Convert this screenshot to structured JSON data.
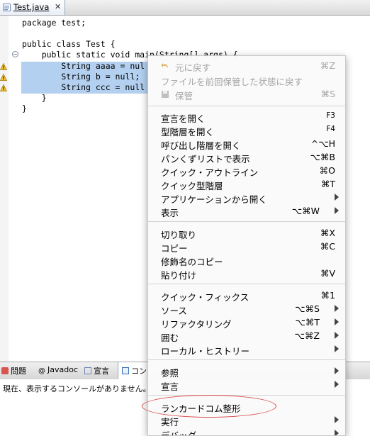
{
  "editor": {
    "tab_label": "Test.java",
    "close_symbol": "✕",
    "lines": [
      "package test;",
      "",
      "public class Test {",
      "    public static void main(String[] args) {",
      "        String aaaa = null;",
      "        String b = null;",
      "        String ccc = null;",
      "    }",
      "}"
    ],
    "line_fragments": {
      "l1": "package test;",
      "l3": "public class Test {",
      "l4": "    public static void main(String[] args) {",
      "l5": "        String aaaa = nul",
      "l6": "        String b = null;",
      "l7": "        String ccc = null",
      "l8": "    }",
      "l9": "}"
    },
    "fold_symbol": "−"
  },
  "bottom": {
    "tabs": [
      "問題",
      "Javadoc",
      "宣言",
      "コン"
    ],
    "console_message": "現在、表示するコンソールがありません。"
  },
  "menu": {
    "undo": {
      "label": "元に戻す",
      "shortcut": "⌘Z"
    },
    "revert": {
      "label": "ファイルを前回保管した状態に戻す"
    },
    "save": {
      "label": "保管",
      "shortcut": "⌘S"
    },
    "open_declaration": {
      "label": "宣言を開く",
      "shortcut": "F3"
    },
    "open_type_hierarchy": {
      "label": "型階層を開く",
      "shortcut": "F4"
    },
    "open_call_hierarchy": {
      "label": "呼び出し階層を開く",
      "shortcut": "^⌥H"
    },
    "show_in_breadcrumb": {
      "label": "パンくずリストで表示",
      "shortcut": "⌥⌘B"
    },
    "quick_outline": {
      "label": "クイック・アウトライン",
      "shortcut": "⌘O"
    },
    "quick_type_hierarchy": {
      "label": "クイック型階層",
      "shortcut": "⌘T"
    },
    "open_with": {
      "label": "アプリケーションから開く"
    },
    "show_in": {
      "label": "表示",
      "shortcut": "⌥⌘W"
    },
    "cut": {
      "label": "切り取り",
      "shortcut": "⌘X"
    },
    "copy": {
      "label": "コピー",
      "shortcut": "⌘C"
    },
    "copy_qualified": {
      "label": "修飾名のコピー"
    },
    "paste": {
      "label": "貼り付け",
      "shortcut": "⌘V"
    },
    "quick_fix": {
      "label": "クイック・フィックス",
      "shortcut": "⌘1"
    },
    "source": {
      "label": "ソース",
      "shortcut": "⌥⌘S"
    },
    "refactor": {
      "label": "リファクタリング",
      "shortcut": "⌥⌘T"
    },
    "surround": {
      "label": "囲む",
      "shortcut": "⌥⌘Z"
    },
    "local_history": {
      "label": "ローカル・ヒストリー"
    },
    "references": {
      "label": "参照"
    },
    "declarations": {
      "label": "宣言"
    },
    "lancard": {
      "label": "ランカードコム整形"
    },
    "run": {
      "label": "実行"
    },
    "debug": {
      "label": "デバッグ"
    }
  },
  "colors": {
    "selection": "#b4d0f0",
    "annotation": "#d94a4a",
    "keyword": "#7f0055"
  }
}
